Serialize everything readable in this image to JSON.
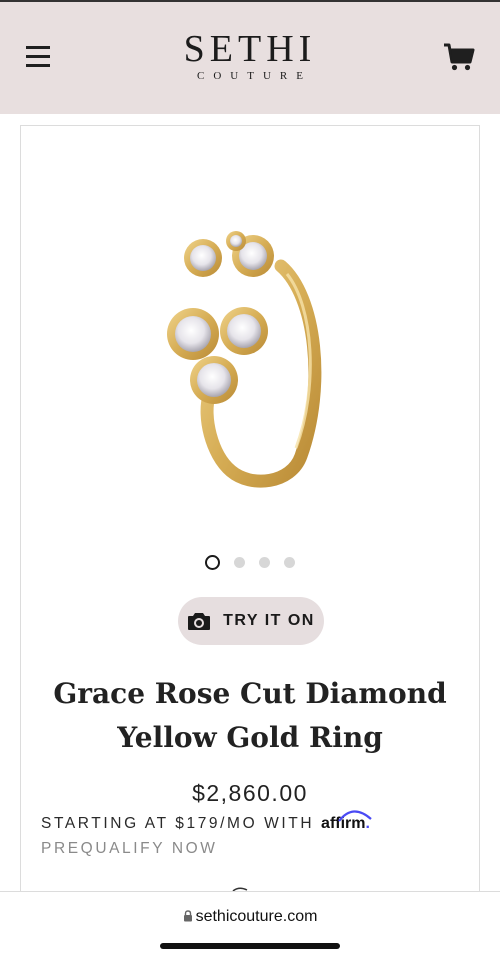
{
  "header": {
    "logo_main": "SETHI",
    "logo_sub": "COUTURE",
    "menu_icon": "hamburger-menu-icon",
    "cart_icon": "shopping-cart-icon"
  },
  "gallery": {
    "image_alt": "yellow gold ring with rose cut diamonds",
    "dots": 4,
    "active_index": 0
  },
  "try_on": {
    "label": "TRY IT ON",
    "icon": "camera-icon"
  },
  "product": {
    "title_line1": "Grace Rose Cut Diamond",
    "title_line2": "Yellow Gold Ring",
    "price": "$2,860.00"
  },
  "financing": {
    "text": "STARTING AT $179/MO WITH ",
    "brand": "affirm",
    "brand_period": ".",
    "prequalify": "PREQUALIFY NOW"
  },
  "browser": {
    "url": "sethicouture.com",
    "lock_icon": "lock-icon"
  },
  "colors": {
    "header_bg": "#e8dfdf",
    "button_bg": "#e6dedf",
    "gold": "#d9b562",
    "affirm_blue": "#4a4af4"
  }
}
